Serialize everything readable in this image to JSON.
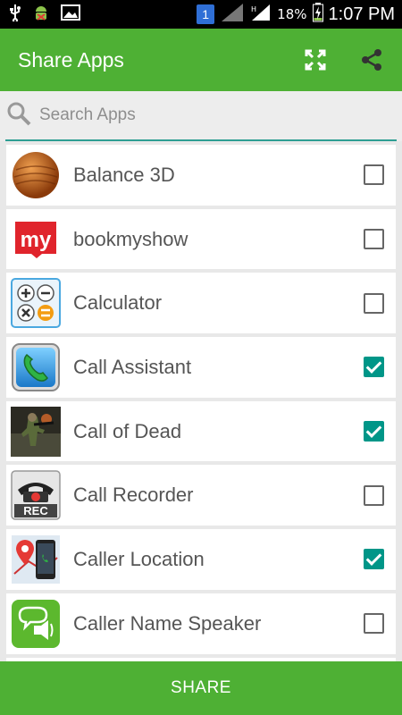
{
  "status_bar": {
    "sim_slot": "1",
    "battery_percent": "18%",
    "time": "1:07 PM"
  },
  "app_bar": {
    "title": "Share Apps",
    "actions": [
      "fullscreen-icon",
      "share-icon"
    ]
  },
  "search": {
    "placeholder": "Search Apps",
    "value": ""
  },
  "apps": [
    {
      "label": "Balance 3D",
      "checked": false,
      "icon": "balance-3d-icon"
    },
    {
      "label": "bookmyshow",
      "checked": false,
      "icon": "bookmyshow-icon"
    },
    {
      "label": "Calculator",
      "checked": false,
      "icon": "calculator-icon"
    },
    {
      "label": "Call Assistant",
      "checked": true,
      "icon": "call-assistant-icon"
    },
    {
      "label": "Call of Dead",
      "checked": true,
      "icon": "call-of-dead-icon"
    },
    {
      "label": "Call Recorder",
      "checked": false,
      "icon": "call-recorder-icon"
    },
    {
      "label": "Caller Location",
      "checked": true,
      "icon": "caller-location-icon"
    },
    {
      "label": "Caller Name Speaker",
      "checked": false,
      "icon": "caller-name-speaker-icon"
    }
  ],
  "footer": {
    "share_label": "SHARE"
  },
  "colors": {
    "primary": "#4eb034",
    "accent": "#009688",
    "status_bar": "#000000"
  }
}
